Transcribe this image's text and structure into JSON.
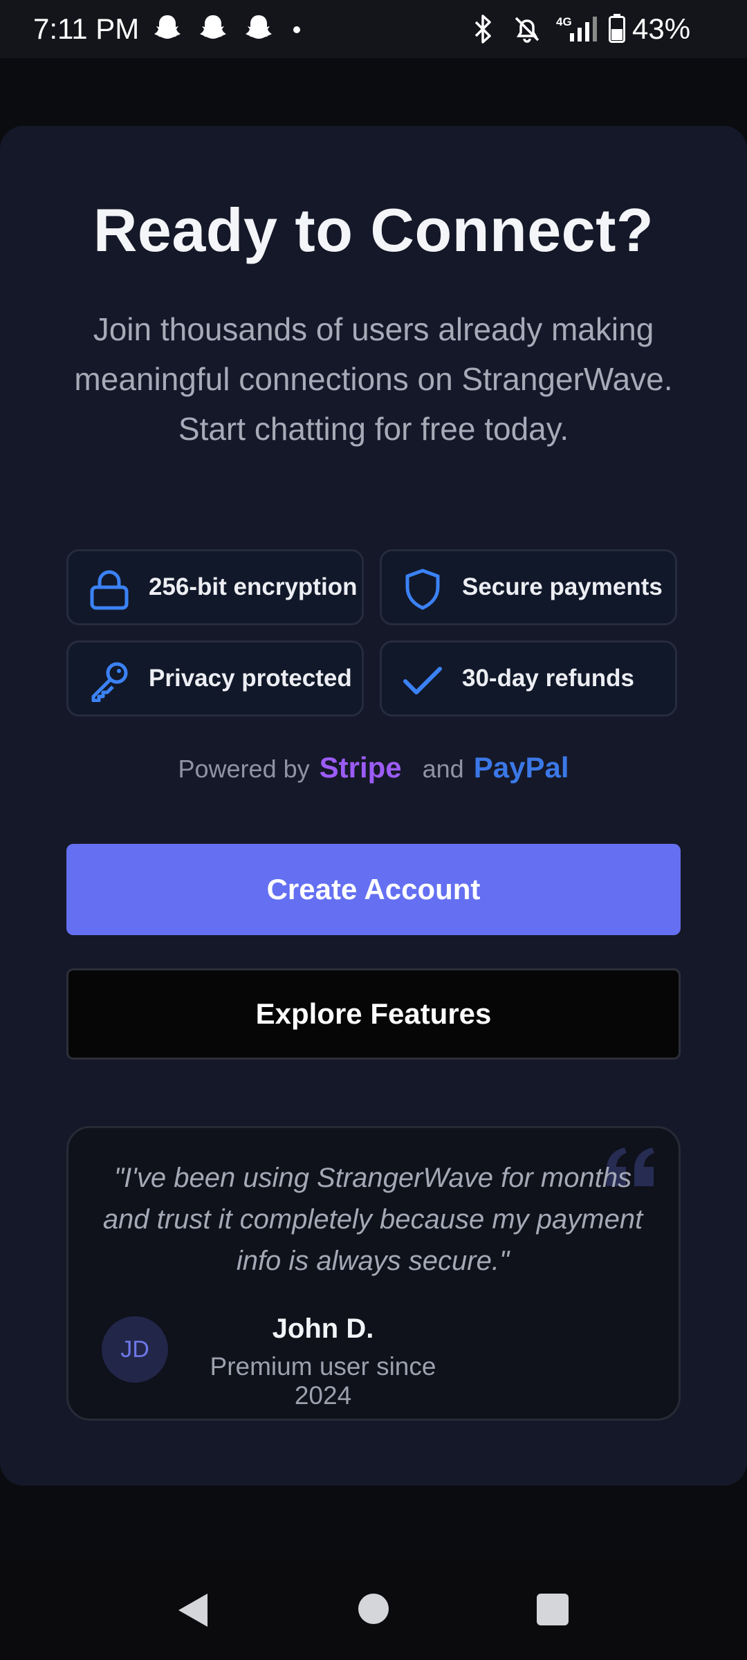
{
  "status_bar": {
    "time": "7:11 PM",
    "notification_icons": [
      "snapchat-ghost-icon",
      "snapchat-ghost-icon",
      "snapchat-ghost-icon",
      "dot-icon"
    ],
    "network": "4G",
    "battery_percent": "43%"
  },
  "hero": {
    "title": "Ready to Connect?",
    "subtitle": "Join thousands of users already making meaningful connections on StrangerWave. Start chatting for free today."
  },
  "features": [
    {
      "label": "256-bit encryption",
      "icon": "lock-icon"
    },
    {
      "label": "Secure payments",
      "icon": "shield-icon"
    },
    {
      "label": "Privacy protected",
      "icon": "key-icon"
    },
    {
      "label": "30-day refunds",
      "icon": "check-icon"
    }
  ],
  "powered_by": {
    "prefix": "Powered by",
    "provider1": "Stripe",
    "joiner": "and",
    "provider2": "PayPal"
  },
  "buttons": {
    "primary": "Create Account",
    "secondary": "Explore Features"
  },
  "testimonial": {
    "quote": "\"I've been using StrangerWave for months and trust it completely because my payment info is always secure.\"",
    "initials": "JD",
    "name": "John D.",
    "role": "Premium user since 2024"
  },
  "colors": {
    "accent": "#6470f1",
    "icon_blue": "#3b82f6",
    "stripe": "#9b5cf6",
    "paypal": "#3b78e7",
    "card_bg": "#151828"
  }
}
